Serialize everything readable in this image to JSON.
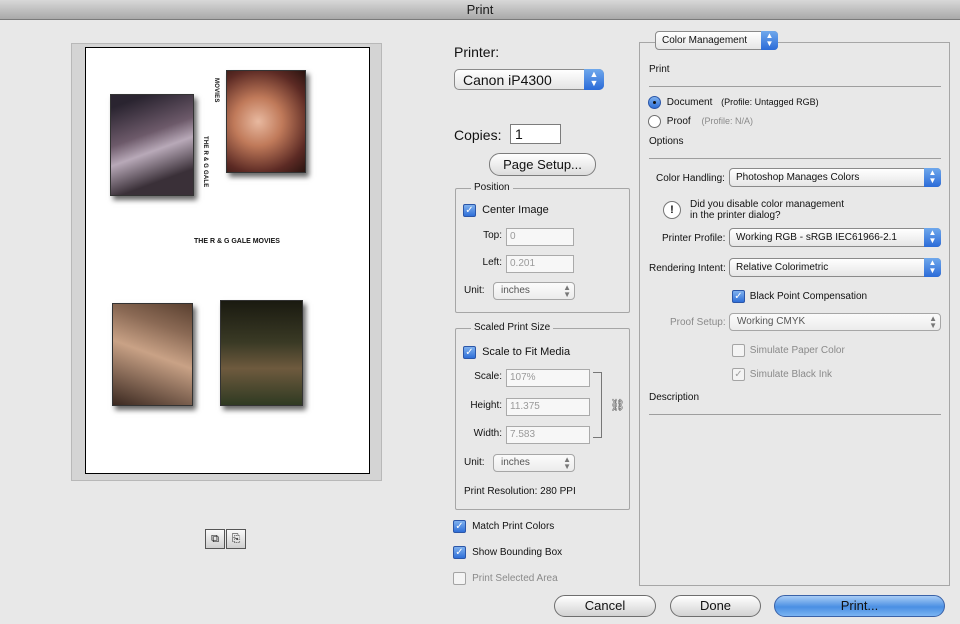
{
  "window": {
    "title": "Print"
  },
  "preview": {
    "vertical_text_1": "MOVIES",
    "vertical_text_2": "THE R & G GALE",
    "caption": "THE R & G GALE MOVIES"
  },
  "printer": {
    "label": "Printer:",
    "selected": "Canon iP4300"
  },
  "copies": {
    "label": "Copies:",
    "value": "1"
  },
  "page_setup_label": "Page Setup...",
  "position": {
    "title": "Position",
    "center_image_label": "Center Image",
    "center_image_checked": true,
    "top_label": "Top:",
    "top_value": "0",
    "left_label": "Left:",
    "left_value": "0.201",
    "unit_label": "Unit:",
    "unit_value": "inches"
  },
  "scaled_print_size": {
    "title": "Scaled Print Size",
    "scale_to_fit_label": "Scale to Fit Media",
    "scale_to_fit_checked": true,
    "scale_label": "Scale:",
    "scale_value": "107%",
    "height_label": "Height:",
    "height_value": "11.375",
    "width_label": "Width:",
    "width_value": "7.583",
    "unit_label": "Unit:",
    "unit_value": "inches",
    "resolution_text": "Print Resolution: 280 PPI"
  },
  "options_left": {
    "match_print_colors_label": "Match Print Colors",
    "match_print_colors_checked": true,
    "show_bounding_box_label": "Show Bounding Box",
    "show_bounding_box_checked": true,
    "print_selected_area_label": "Print Selected Area",
    "print_selected_area_checked": false
  },
  "color_management": {
    "section_popup": "Color Management",
    "print_heading": "Print",
    "document_label": "Document",
    "document_profile": "(Profile: Untagged RGB)",
    "proof_label": "Proof",
    "proof_profile": "(Profile: N/A)",
    "options_heading": "Options",
    "color_handling_label": "Color Handling:",
    "color_handling_value": "Photoshop Manages Colors",
    "warning_text_line1": "Did you disable color management",
    "warning_text_line2": "in the printer dialog?",
    "printer_profile_label": "Printer Profile:",
    "printer_profile_value": "Working RGB - sRGB IEC61966-2.1",
    "rendering_intent_label": "Rendering Intent:",
    "rendering_intent_value": "Relative Colorimetric",
    "black_point_label": "Black Point Compensation",
    "black_point_checked": true,
    "proof_setup_label": "Proof Setup:",
    "proof_setup_value": "Working CMYK",
    "simulate_paper_label": "Simulate Paper Color",
    "simulate_black_label": "Simulate Black Ink",
    "description_heading": "Description"
  },
  "buttons": {
    "cancel": "Cancel",
    "done": "Done",
    "print": "Print..."
  }
}
